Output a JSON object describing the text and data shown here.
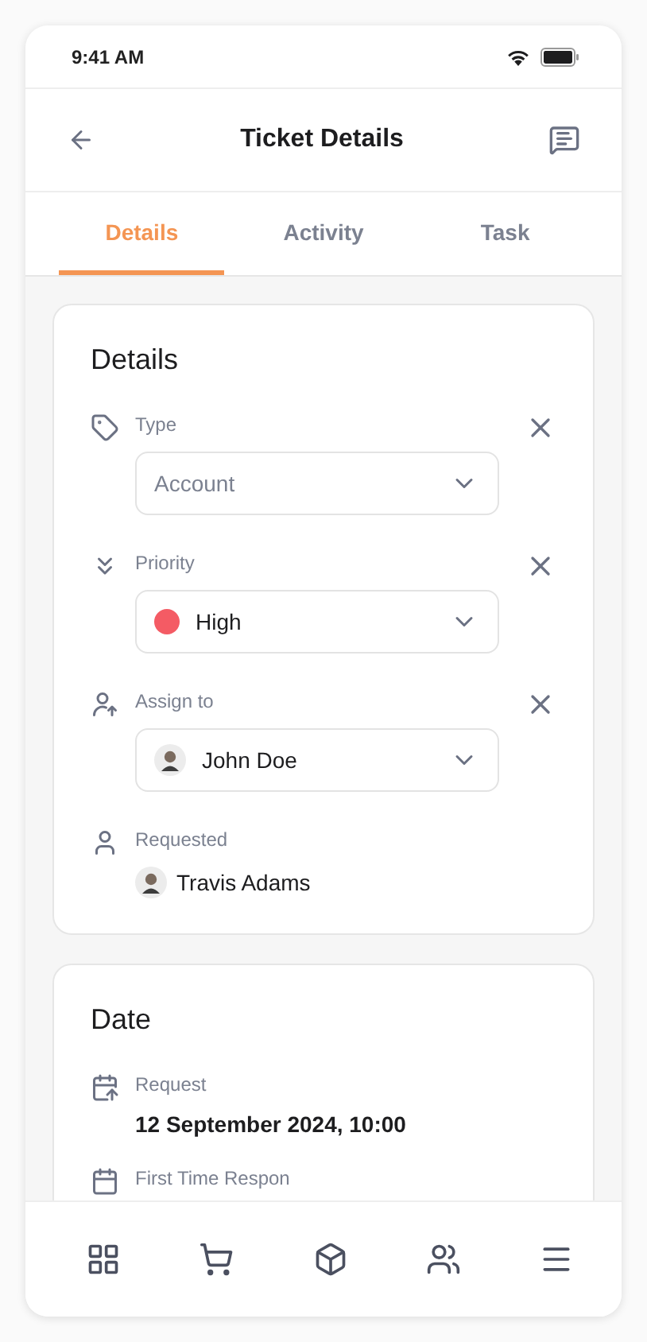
{
  "status_bar": {
    "time": "9:41 AM"
  },
  "header": {
    "title": "Ticket Details"
  },
  "tabs": [
    {
      "label": "Details",
      "selected": true
    },
    {
      "label": "Activity",
      "selected": false
    },
    {
      "label": "Task",
      "selected": false
    }
  ],
  "details_card": {
    "title": "Details",
    "fields": [
      {
        "kind": "select-text",
        "label": "Type",
        "placeholder": "Account"
      },
      {
        "kind": "select-color",
        "label": "Priority",
        "value": "High",
        "color": "#f45b64"
      },
      {
        "kind": "select-person",
        "label": "Assign to",
        "value": "John Doe"
      },
      {
        "kind": "person",
        "label": "Requested",
        "value": "Travis Adams"
      }
    ]
  },
  "date_card": {
    "title": "Date",
    "items": [
      {
        "label": "Request",
        "value": "12 September 2024, 10:00"
      },
      {
        "label": "First Time Respon"
      }
    ]
  }
}
